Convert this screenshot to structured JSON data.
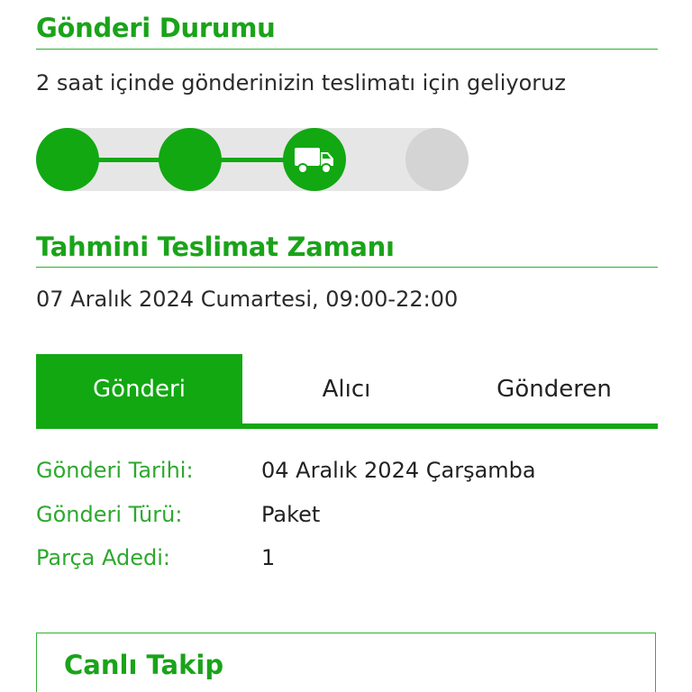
{
  "status": {
    "title": "Gönderi Durumu",
    "message": "2 saat içinde gönderinizin teslimatı için geliyoruz",
    "steps_total": 4,
    "steps_completed": 3,
    "current_step_icon": "truck-icon"
  },
  "eta": {
    "title": "Tahmini Teslimat Zamanı",
    "value": "07 Aralık 2024 Cumartesi, 09:00-22:00"
  },
  "tabs": [
    {
      "label": "Gönderi",
      "active": true
    },
    {
      "label": "Alıcı",
      "active": false
    },
    {
      "label": "Gönderen",
      "active": false
    }
  ],
  "details": [
    {
      "label": "Gönderi Tarihi:",
      "value": "04 Aralık 2024 Çarşamba"
    },
    {
      "label": "Gönderi Türü:",
      "value": "Paket"
    },
    {
      "label": "Parça Adedi:",
      "value": "1"
    }
  ],
  "live_tracking": {
    "title": "Canlı Takip"
  },
  "colors": {
    "accent": "#12a812",
    "accent_text": "#1aa31a",
    "track_bg": "#e6e6e6",
    "pending_step": "#d4d4d4"
  }
}
